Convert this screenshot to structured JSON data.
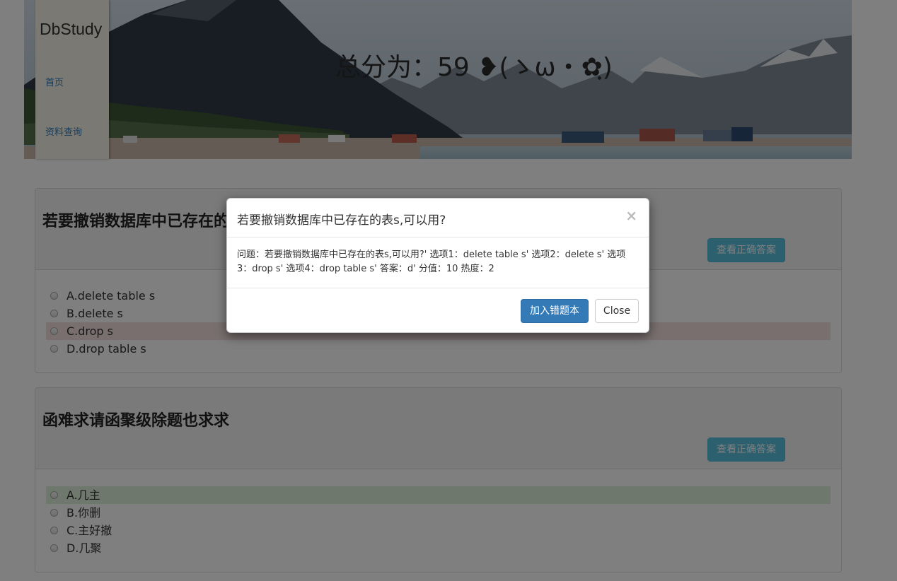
{
  "header": {
    "score_text": "总分为：59 ❥(ゝω・✿ฺ)",
    "brand": "DbStudy",
    "nav": [
      {
        "label": "首页"
      },
      {
        "label": "资料查询"
      }
    ]
  },
  "questions": [
    {
      "title": "若要撤销数据库中已存在的表s,可以用?",
      "answer_button": "查看正确答案",
      "options": [
        {
          "label": "A.delete table s",
          "state": "none"
        },
        {
          "label": "B.delete s",
          "state": "none"
        },
        {
          "label": "C.drop s",
          "state": "wrong"
        },
        {
          "label": "D.drop table s",
          "state": "none"
        }
      ]
    },
    {
      "title": "函难求请函聚级除题也求求",
      "answer_button": "查看正确答案",
      "options": [
        {
          "label": "A.几主",
          "state": "correct"
        },
        {
          "label": "B.你删",
          "state": "none"
        },
        {
          "label": "C.主好撤",
          "state": "none"
        },
        {
          "label": "D.几聚",
          "state": "none"
        }
      ]
    }
  ],
  "modal": {
    "title": "若要撤销数据库中已存在的表s,可以用?",
    "close_symbol": "×",
    "body_line1": "问题：若要撤销数据库中已存在的表s,可以用?' 选项1：delete table s' 选项2：delete s' 选项",
    "body_line2": "3：drop s' 选项4：drop table s' 答案：d' 分值：10 热度：2",
    "primary_button": "加入错题本",
    "close_button": "Close"
  },
  "colors": {
    "primary": "#337ab7",
    "info": "#5bc0de",
    "wrong_highlight": "#f2dede",
    "correct_highlight": "#dff0d8"
  }
}
